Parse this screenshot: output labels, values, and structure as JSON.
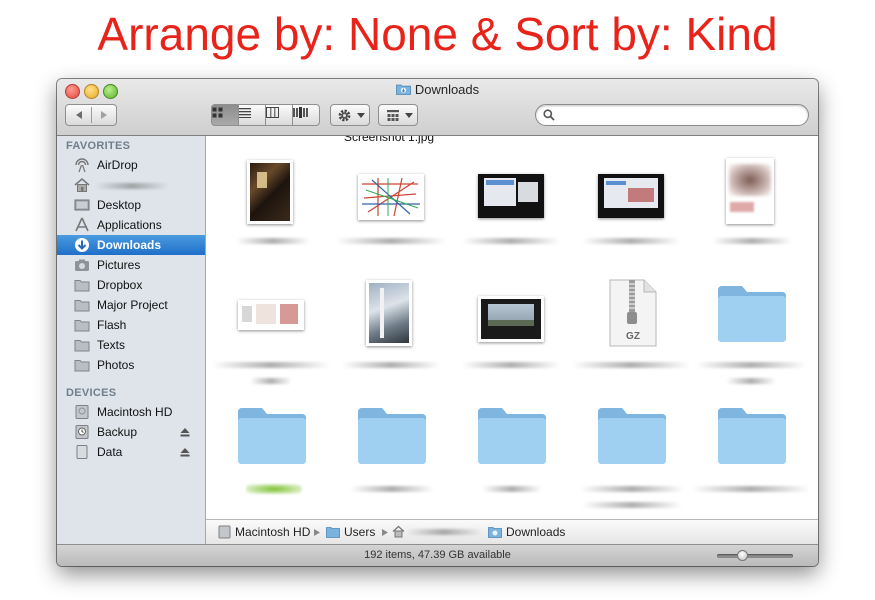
{
  "caption": "Arrange by: None & Sort by: Kind",
  "window": {
    "title": "Downloads",
    "search": {
      "value": "",
      "placeholder": ""
    }
  },
  "sidebar": {
    "favorites_header": "FAVORITES",
    "favorites": [
      {
        "label": "AirDrop",
        "icon": "airdrop-icon"
      },
      {
        "label": "",
        "icon": "home-icon"
      },
      {
        "label": "Desktop",
        "icon": "desktop-icon"
      },
      {
        "label": "Applications",
        "icon": "applications-icon"
      },
      {
        "label": "Downloads",
        "icon": "downloads-icon",
        "selected": true
      },
      {
        "label": "Pictures",
        "icon": "pictures-icon"
      },
      {
        "label": "Dropbox",
        "icon": "folder-icon"
      },
      {
        "label": "Major Project",
        "icon": "folder-icon"
      },
      {
        "label": "Flash",
        "icon": "folder-icon"
      },
      {
        "label": "Texts",
        "icon": "folder-icon"
      },
      {
        "label": "Photos",
        "icon": "folder-icon"
      }
    ],
    "devices_header": "DEVICES",
    "devices": [
      {
        "label": "Macintosh HD",
        "icon": "hard-drive-icon"
      },
      {
        "label": "Backup",
        "icon": "time-machine-drive-icon"
      },
      {
        "label": "Data",
        "icon": "external-drive-icon"
      }
    ]
  },
  "content": {
    "cut_off_label": "Screenshot 1.jpg",
    "gz_label": "GZ"
  },
  "pathbar": {
    "segments": [
      "Macintosh HD",
      "Users",
      "",
      "Downloads"
    ]
  },
  "status": {
    "text": "192 items, 47.39 GB available",
    "icon_size_fraction": 0.3
  },
  "colors": {
    "caption": "#e8231a",
    "selection": "#2a7bd4",
    "folder": "#8cc4ea"
  }
}
